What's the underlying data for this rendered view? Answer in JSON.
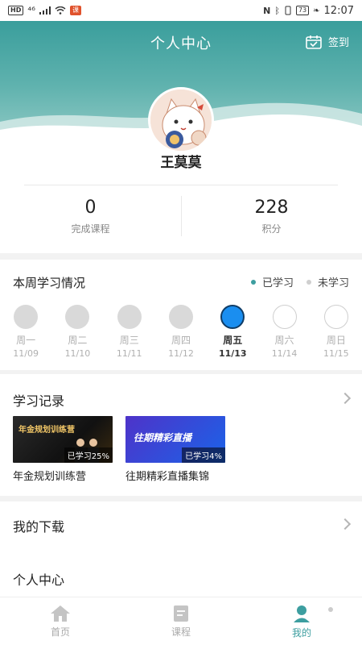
{
  "status_bar": {
    "left_text": "HD",
    "signal_label": "⁴⁶",
    "battery": "73",
    "time": "12:07"
  },
  "header": {
    "title": "个人中心",
    "signin_label": "签到"
  },
  "profile": {
    "username": "王莫莫",
    "stats": [
      {
        "value": "0",
        "label": "完成课程"
      },
      {
        "value": "228",
        "label": "积分"
      }
    ]
  },
  "weekly": {
    "title": "本周学习情况",
    "legend": {
      "studied": "已学习",
      "not_studied": "未学习"
    },
    "legend_colors": {
      "studied": "#3d9ea0",
      "not_studied": "#cfcfcf"
    },
    "days": [
      {
        "name": "周一",
        "date": "11/09",
        "state": "studied"
      },
      {
        "name": "周二",
        "date": "11/10",
        "state": "studied"
      },
      {
        "name": "周三",
        "date": "11/11",
        "state": "studied"
      },
      {
        "name": "周四",
        "date": "11/12",
        "state": "studied"
      },
      {
        "name": "周五",
        "date": "11/13",
        "state": "today"
      },
      {
        "name": "周六",
        "date": "11/14",
        "state": "future"
      },
      {
        "name": "周日",
        "date": "11/15",
        "state": "future"
      }
    ]
  },
  "records": {
    "title": "学习记录",
    "items": [
      {
        "title": "年金规划训练营",
        "thumb_text": "年金规划训练营",
        "progress": "已学习25%"
      },
      {
        "title": "往期精彩直播集锦",
        "thumb_text": "往期精彩直播",
        "progress": "已学习4%"
      }
    ]
  },
  "menu": {
    "downloads": "我的下载",
    "personal": "个人中心"
  },
  "tabbar": {
    "items": [
      {
        "label": "首页",
        "icon": "home-icon"
      },
      {
        "label": "课程",
        "icon": "course-icon"
      },
      {
        "label": "我的",
        "icon": "profile-icon"
      }
    ],
    "active": "我的",
    "accent": "#3d9ea0"
  }
}
